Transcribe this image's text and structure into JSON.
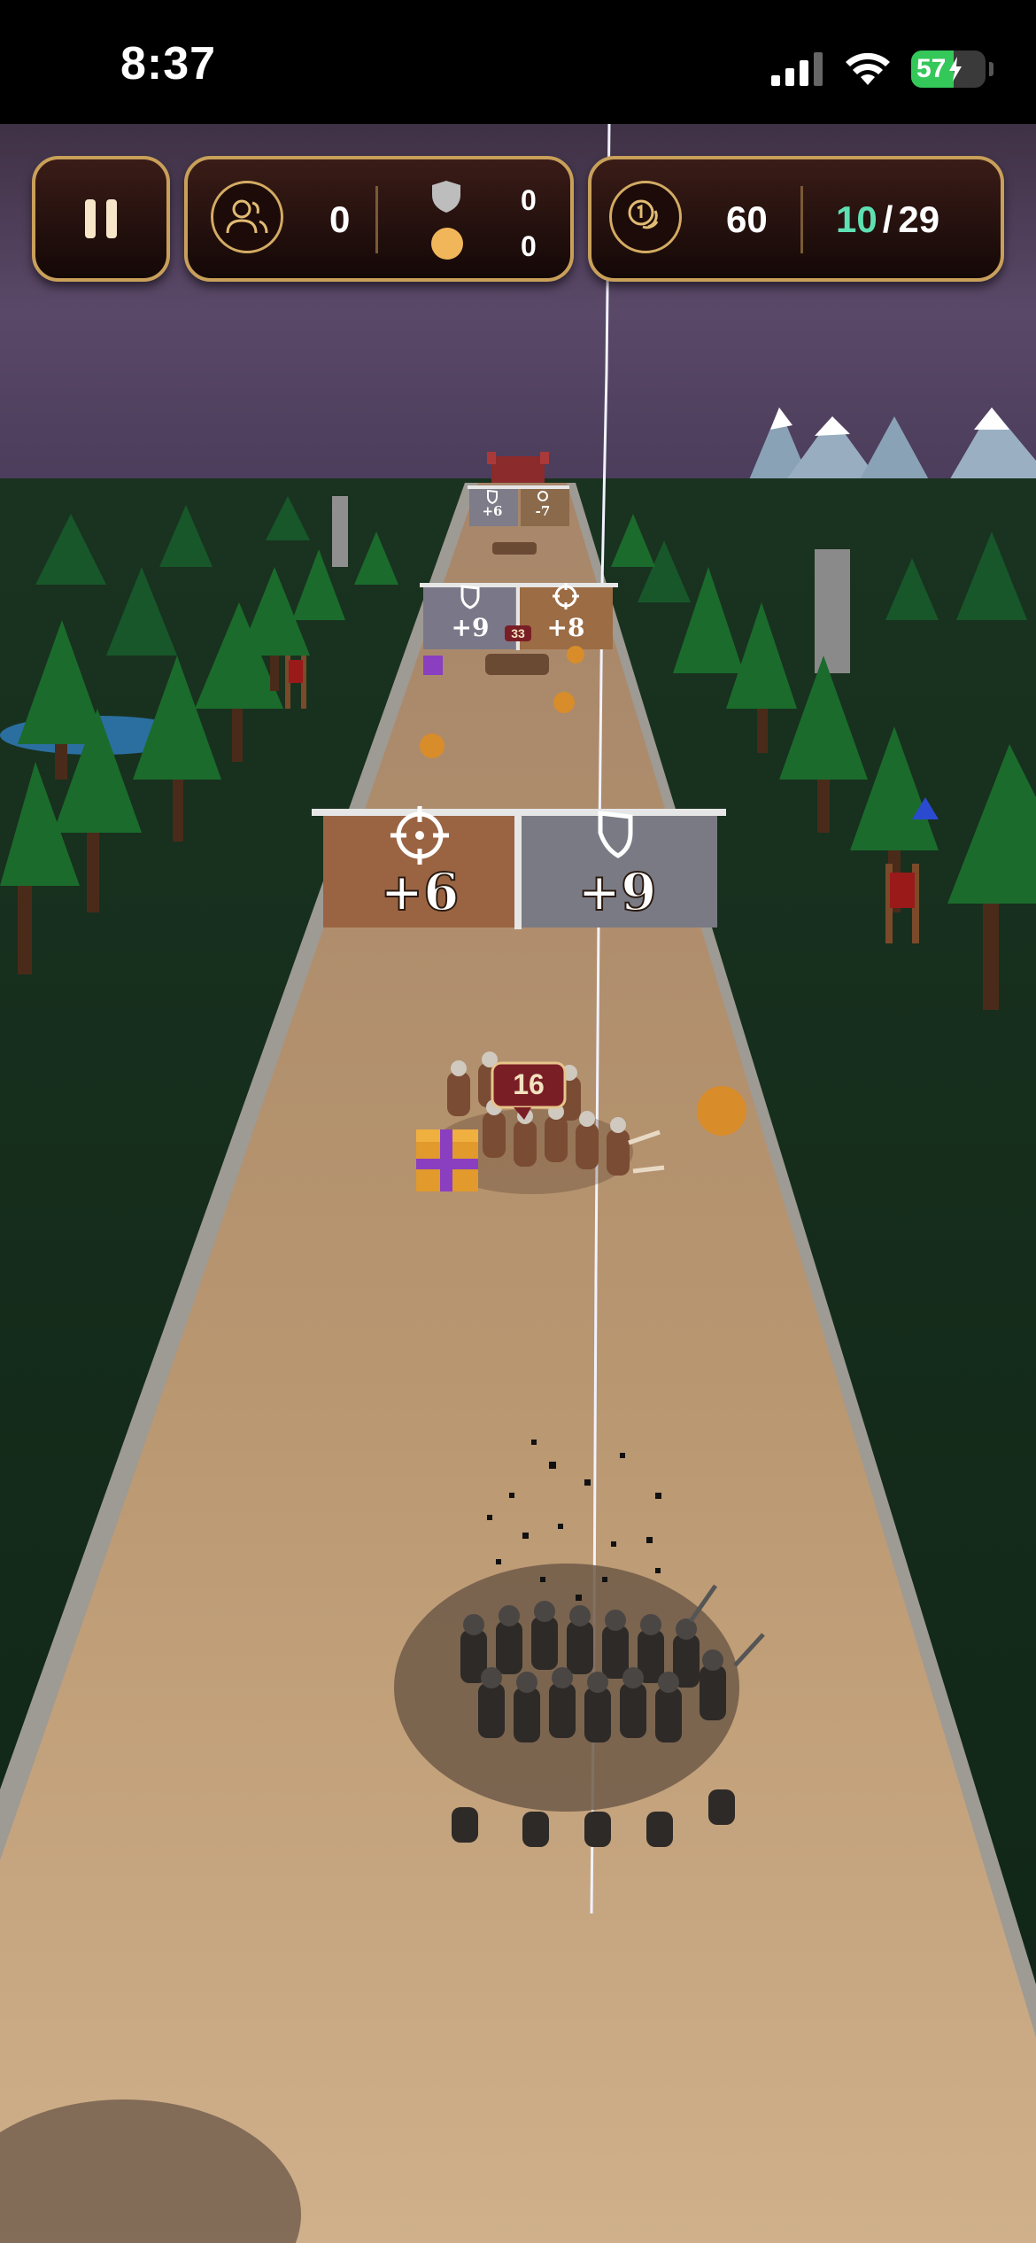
{
  "status_bar": {
    "time": "8:37",
    "battery_level": 57,
    "battery_text": "57"
  },
  "hud": {
    "army_count": "0",
    "shield_count": "0",
    "orb_count": "0",
    "coins": "60",
    "level_current": "10",
    "level_separator": "/",
    "level_total": "29"
  },
  "gates": {
    "near_left": {
      "label": "+6",
      "icon": "crosshair-icon"
    },
    "near_right": {
      "label": "+9",
      "icon": "shield-icon"
    },
    "mid_left": {
      "label": "+9",
      "icon": "shield-icon"
    },
    "mid_right": {
      "label": "+8",
      "icon": "crosshair-icon"
    },
    "far_left": {
      "label": "+6",
      "icon": "shield-icon"
    },
    "far_right": {
      "label": "-7",
      "icon": "crosshair-icon"
    }
  },
  "enemy_group_near": {
    "count": "16"
  },
  "enemy_group_mid": {
    "count": "33"
  },
  "colors": {
    "road": "#c4a27a",
    "grass": "#1f3a22",
    "sky": "#4a3a5c",
    "hud_border": "#c9a05a",
    "level_accent": "#5fe0b3"
  }
}
